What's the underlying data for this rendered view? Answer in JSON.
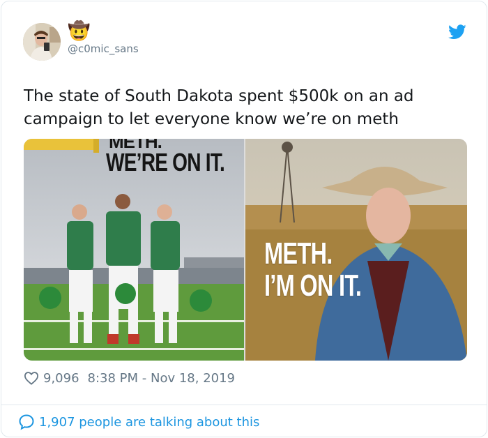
{
  "user": {
    "display_emoji": "🤠",
    "handle": "@c0mic_sans",
    "avatar_icon": "avatar-photo"
  },
  "tweet": {
    "text": "The state of South Dakota spent $500k on an ad campaign to let everyone know we’re on meth",
    "likes": "9,096",
    "timestamp": "8:38 PM - Nov 18, 2019",
    "talking": "1,907 people are talking about this"
  },
  "media": {
    "left_ad_top": "METH.",
    "left_ad_main": "WE’RE ON IT.",
    "right_ad_line1": "METH.",
    "right_ad_line2": "I’M ON IT."
  },
  "colors": {
    "twitter_blue": "#1da1f2",
    "link_blue": "#1b95e0",
    "meta_gray": "#657786",
    "border": "#e1e8ed"
  },
  "icons": [
    "twitter-bird-icon",
    "heart-icon",
    "speech-bubble-icon"
  ]
}
